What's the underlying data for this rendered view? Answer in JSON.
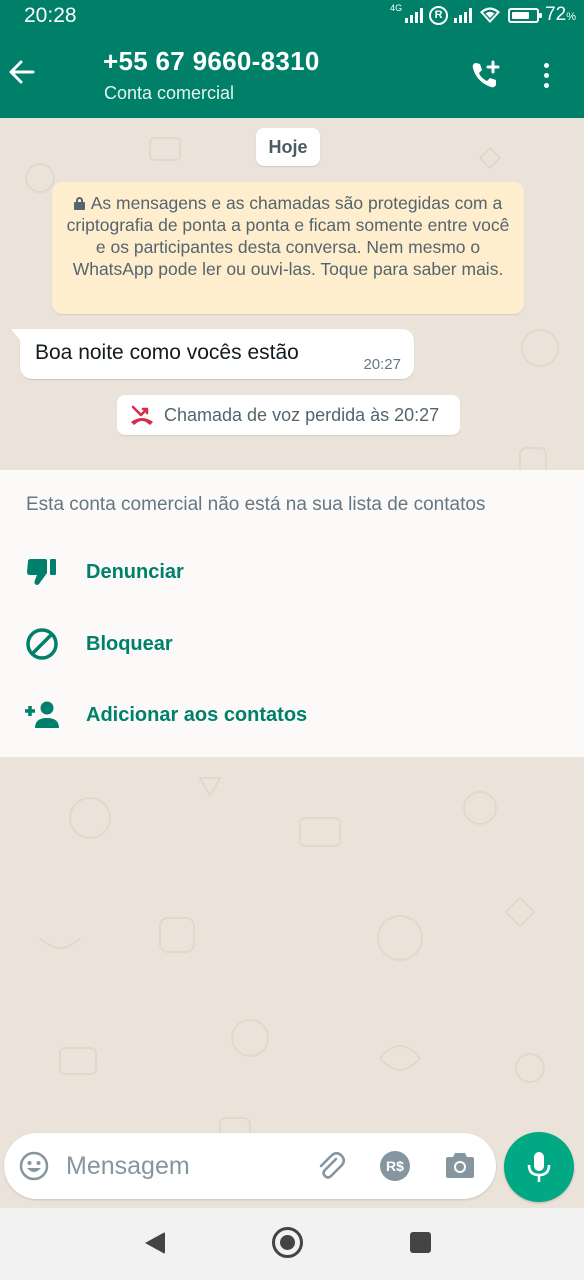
{
  "status_bar": {
    "time": "20:28",
    "network_label": "4G",
    "battery_percent": "72",
    "battery_unit": "%",
    "battery_level": 0.72
  },
  "header": {
    "contact_name": "+55 67 9660-8310",
    "subtitle": "Conta comercial",
    "icons": [
      "back-arrow-icon",
      "add-call-icon",
      "more-vert-icon"
    ]
  },
  "chat": {
    "date_chip": "Hoje",
    "encryption_notice": "As mensagens e as chamadas são protegidas com a criptografia de ponta a ponta e ficam somente entre você e os participantes desta conversa. Nem mesmo o WhatsApp pode ler ou ouvi-las. Toque para saber mais.",
    "messages": [
      {
        "text": "Boa noite como vocês estão",
        "time": "20:27",
        "direction": "incoming"
      }
    ],
    "missed_call": "Chamada de voz perdida às 20:27"
  },
  "business_panel": {
    "note": "Esta conta comercial não está na sua lista de contatos",
    "actions": [
      {
        "label": "Denunciar",
        "icon": "thumb-down-icon"
      },
      {
        "label": "Bloquear",
        "icon": "block-icon"
      },
      {
        "label": "Adicionar aos contatos",
        "icon": "person-add-icon"
      }
    ]
  },
  "input_bar": {
    "placeholder": "Mensagem",
    "pay_label": "R$"
  },
  "colors": {
    "header": "#008069",
    "accent": "#00a884",
    "action_text": "#00806a",
    "missed_call": "#d42d4a",
    "notice_bg": "#ffeecd"
  }
}
